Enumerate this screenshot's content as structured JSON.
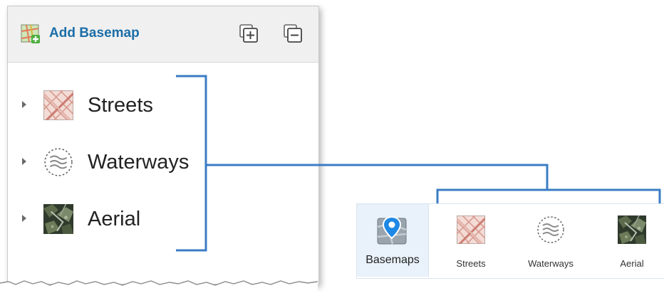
{
  "panel": {
    "add_basemap_label": "Add Basemap",
    "expand_all_icon": "expand-all-icon",
    "collapse_all_icon": "collapse-all-icon",
    "layers": [
      {
        "label": "Streets",
        "icon": "streets-thumbnail-icon"
      },
      {
        "label": "Waterways",
        "icon": "waterways-thumbnail-icon"
      },
      {
        "label": "Aerial",
        "icon": "aerial-thumbnail-icon"
      }
    ]
  },
  "toolbar": {
    "basemaps_label": "Basemaps",
    "basemaps_icon": "basemaps-pin-icon",
    "items": [
      {
        "label": "Streets",
        "icon": "streets-thumbnail-icon"
      },
      {
        "label": "Waterways",
        "icon": "waterways-thumbnail-icon"
      },
      {
        "label": "Aerial",
        "icon": "aerial-thumbnail-icon"
      }
    ]
  },
  "colors": {
    "accent_blue": "#3a7cc4",
    "header_text": "#1b6ea8",
    "active_tool_bg": "#e9f1fa"
  }
}
